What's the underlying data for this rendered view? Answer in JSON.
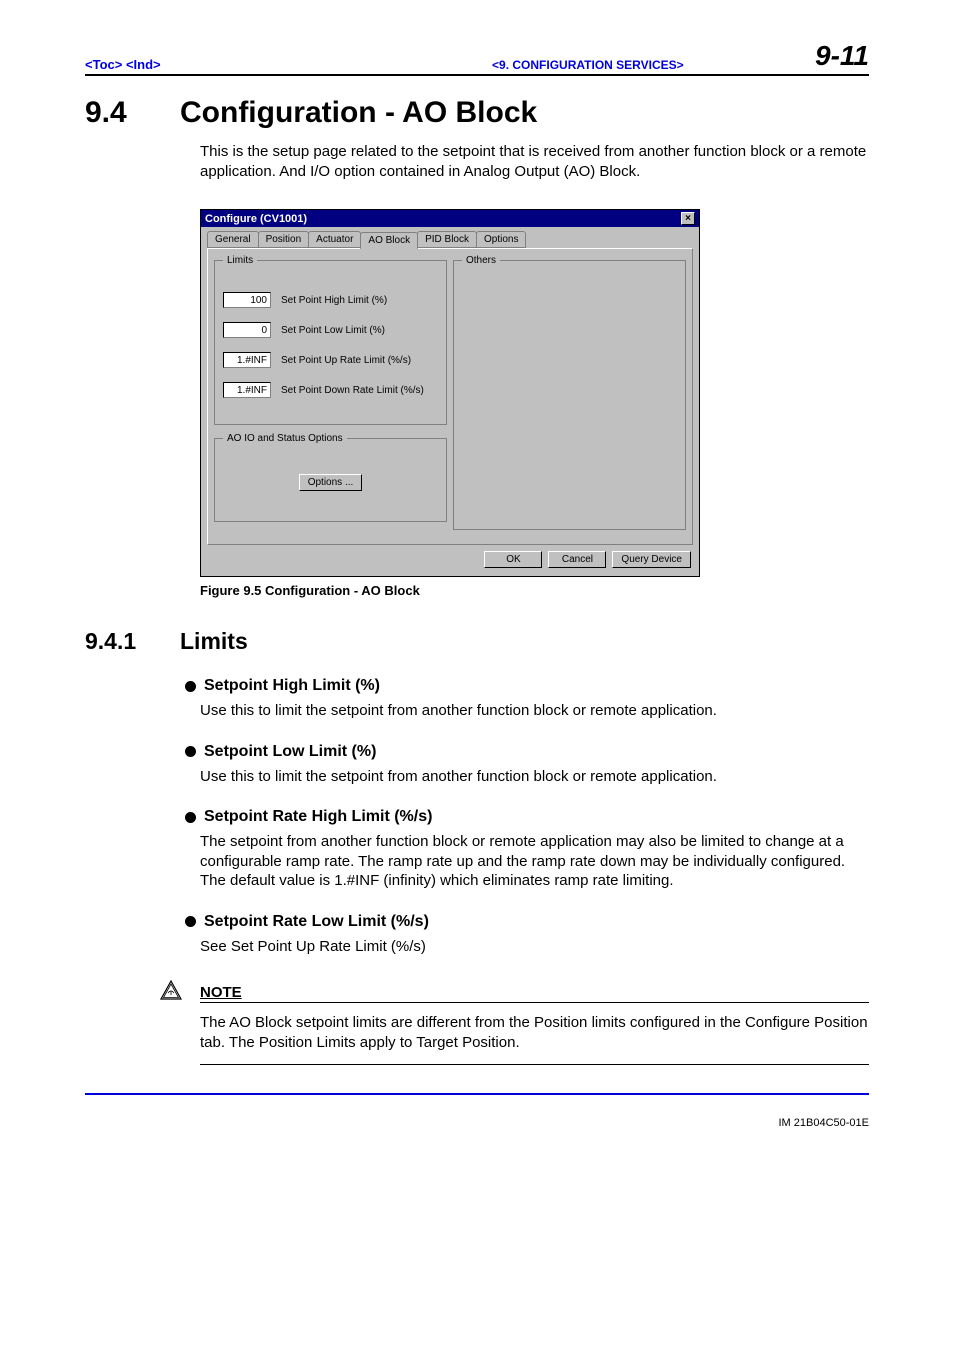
{
  "header": {
    "toc": "<Toc>",
    "ind": "<Ind>",
    "chapter": "<9.  CONFIGURATION SERVICES>",
    "pagenum": "9-11"
  },
  "section": {
    "num": "9.4",
    "title": "Configuration - AO Block",
    "intro": "This is the setup page related to the setpoint that is received from another function block or a remote application.  And I/O option  contained in Analog Output (AO) Block."
  },
  "dialog": {
    "title": "Configure (CV1001)",
    "tabs": [
      "General",
      "Position",
      "Actuator",
      "AO Block",
      "PID Block",
      "Options"
    ],
    "active_tab": "AO Block",
    "limits_legend": "Limits",
    "fields": [
      {
        "value": "100",
        "label": "Set Point High Limit (%)"
      },
      {
        "value": "0",
        "label": "Set Point Low Limit (%)"
      },
      {
        "value": "1.#INF",
        "label": "Set Point Up Rate Limit (%/s)"
      },
      {
        "value": "1.#INF",
        "label": "Set Point Down Rate Limit (%/s)"
      }
    ],
    "ao_legend": "AO IO and Status Options",
    "options_btn": "Options ...",
    "others_legend": "Others",
    "buttons": {
      "ok": "OK",
      "cancel": "Cancel",
      "query": "Query Device"
    }
  },
  "figure_caption": "Figure 9.5  Configuration  - AO Block",
  "subsection": {
    "num": "9.4.1",
    "title": "Limits"
  },
  "bullets": [
    {
      "head": "Setpoint High Limit (%)",
      "body": "Use this to limit the setpoint from another function block or remote application."
    },
    {
      "head": "Setpoint Low Limit (%)",
      "body": "Use this to limit the setpoint from another function block or remote application."
    },
    {
      "head": "Setpoint Rate High Limit (%/s)",
      "body": "The setpoint from another function block or remote application may also be limited to change at a configurable ramp rate.  The ramp rate up and the ramp rate down may be individually configured.  The default value is 1.#INF (infinity) which eliminates ramp rate limiting."
    },
    {
      "head": "Setpoint Rate  Low Limit (%/s)",
      "body": "See Set Point Up Rate Limit (%/s)"
    }
  ],
  "note": {
    "head": "NOTE",
    "body": "The AO Block setpoint limits are different from the Position limits configured in the Configure Position tab.  The Position Limits apply to Target Position."
  },
  "footer_id": "IM 21B04C50-01E"
}
